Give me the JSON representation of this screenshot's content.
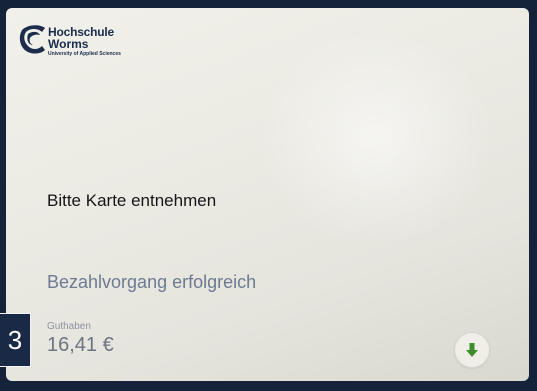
{
  "logo": {
    "name_line1": "Hochschule",
    "name_line2": "Worms",
    "subtitle": "University of Applied Sciences"
  },
  "message": "Bitte Karte entnehmen",
  "status": "Bezahlvorgang erfolgreich",
  "balance": {
    "label": "Guthaben",
    "value": "16,41 €"
  },
  "step_badge": "3",
  "icons": {
    "down_button": "arrow-down-icon",
    "logo_mark": "hochschule-worms-logo-icon"
  },
  "colors": {
    "screen_bg": "#ecebe4",
    "frame": "#14223a",
    "status_text": "#6c7a92",
    "arrow_green": "#3e8f2c",
    "brand_navy": "#1b2c4c"
  }
}
